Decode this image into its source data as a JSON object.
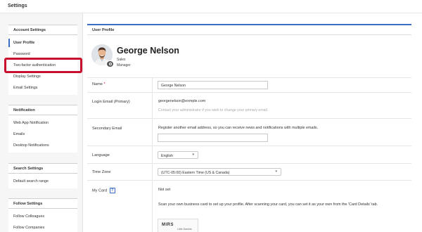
{
  "app": {
    "title": "Settings"
  },
  "sidebar": {
    "groups": [
      {
        "title": "Account Settings",
        "items": [
          "User Profile",
          "Password",
          "Two-factor authentication",
          "Display Settings",
          "Email Settings"
        ]
      },
      {
        "title": "Notification",
        "items": [
          "Web App Notification",
          "Emails",
          "Desktop Notifications"
        ]
      },
      {
        "title": "Search Settings",
        "items": [
          "Default search range"
        ]
      },
      {
        "title": "Follow Settings",
        "items": [
          "Follow Colleagues",
          "Follow Companies"
        ]
      }
    ],
    "active_item": "User Profile",
    "highlighted_item": "Two-factor authentication"
  },
  "profile": {
    "header": "User Profile",
    "name": "George Nelson",
    "department": "Sales",
    "title": "Manager"
  },
  "form": {
    "name": {
      "label": "Name",
      "required_mark": "*",
      "value": "George Nelson"
    },
    "login_email": {
      "label": "Login Email (Primary)",
      "value": "georgenelson@exmple.com",
      "hint": "Contact your administrator if you wish to change your primary email."
    },
    "secondary_email": {
      "label": "Secondary Email",
      "description": "Register another email address, so you can receive news and notifications with multiple emails.",
      "value": ""
    },
    "language": {
      "label": "Language",
      "value": "English"
    },
    "time_zone": {
      "label": "Time Zone",
      "value": "(UTC-05:00) Eastern Time (US & Canada)"
    },
    "my_card": {
      "label": "My Card",
      "help_glyph": "?",
      "status": "Not set",
      "description": "Scan your own business card to set up your profile. After scanning your card, you can set it as your own from the 'Card Details' tab.",
      "card_logo": "MIRS",
      "card_name": "Little Daniels"
    }
  },
  "icons": {
    "camera": "camera-icon",
    "caret": "chevron-down-icon",
    "help": "help-icon"
  },
  "colors": {
    "accent": "#3a6fc4",
    "highlight": "#c8102e",
    "required": "#c8102e"
  }
}
